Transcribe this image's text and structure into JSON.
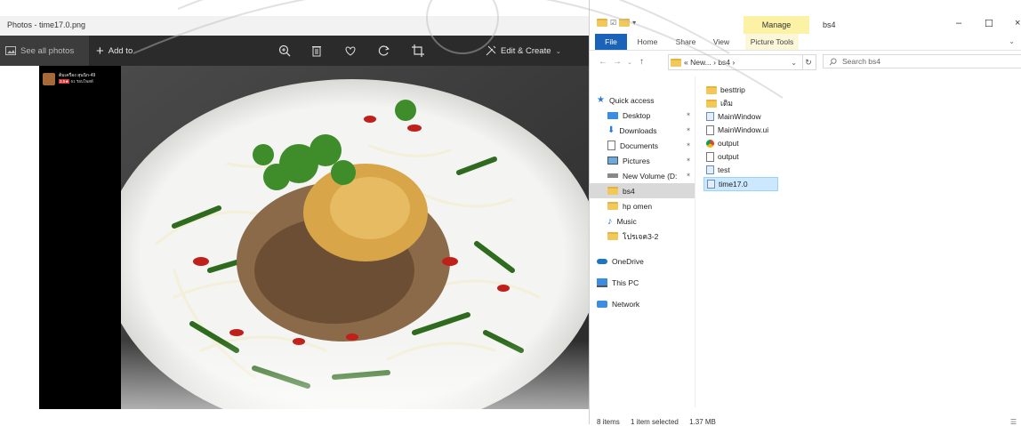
{
  "photos": {
    "window_title": "Photos - time17.0.png",
    "see_all": "See all photos",
    "add_to": "Add to",
    "edit_create": "Edit & Create",
    "person": {
      "name": "ต้มเครือง สุนนิก-49",
      "rating": "3.5★",
      "meta": "61 รอบโพสต์"
    }
  },
  "explorer": {
    "manage_tab": "Manage",
    "window_title": "bs4",
    "ribbon_tabs": {
      "file": "File",
      "home": "Home",
      "share": "Share",
      "view": "View",
      "picture_tools": "Picture Tools"
    },
    "address": {
      "prefix": "«",
      "seg1": "New...",
      "sep": "›",
      "seg2": "bs4"
    },
    "search_placeholder": "Search bs4",
    "nav": {
      "quick_access": "Quick access",
      "desktop": "Desktop",
      "downloads": "Downloads",
      "documents": "Documents",
      "pictures": "Pictures",
      "new_volume": "New Volume (D:",
      "bs4": "bs4",
      "hp_omen": "hp omen",
      "music": "Music",
      "thai_folder": "โปรเจค3-2",
      "onedrive": "OneDrive",
      "this_pc": "This PC",
      "network": "Network"
    },
    "files": [
      "besttrip",
      "เติม",
      "MainWindow",
      "MainWindow.ui",
      "output",
      "output",
      "test",
      "time17.0"
    ],
    "status": {
      "count": "8 items",
      "selected": "1 item selected",
      "size": "1.37 MB"
    }
  },
  "colors": {
    "accent": "#1a63b8",
    "manage": "#fbf2a6",
    "toolbar": "#2b2b2b"
  }
}
